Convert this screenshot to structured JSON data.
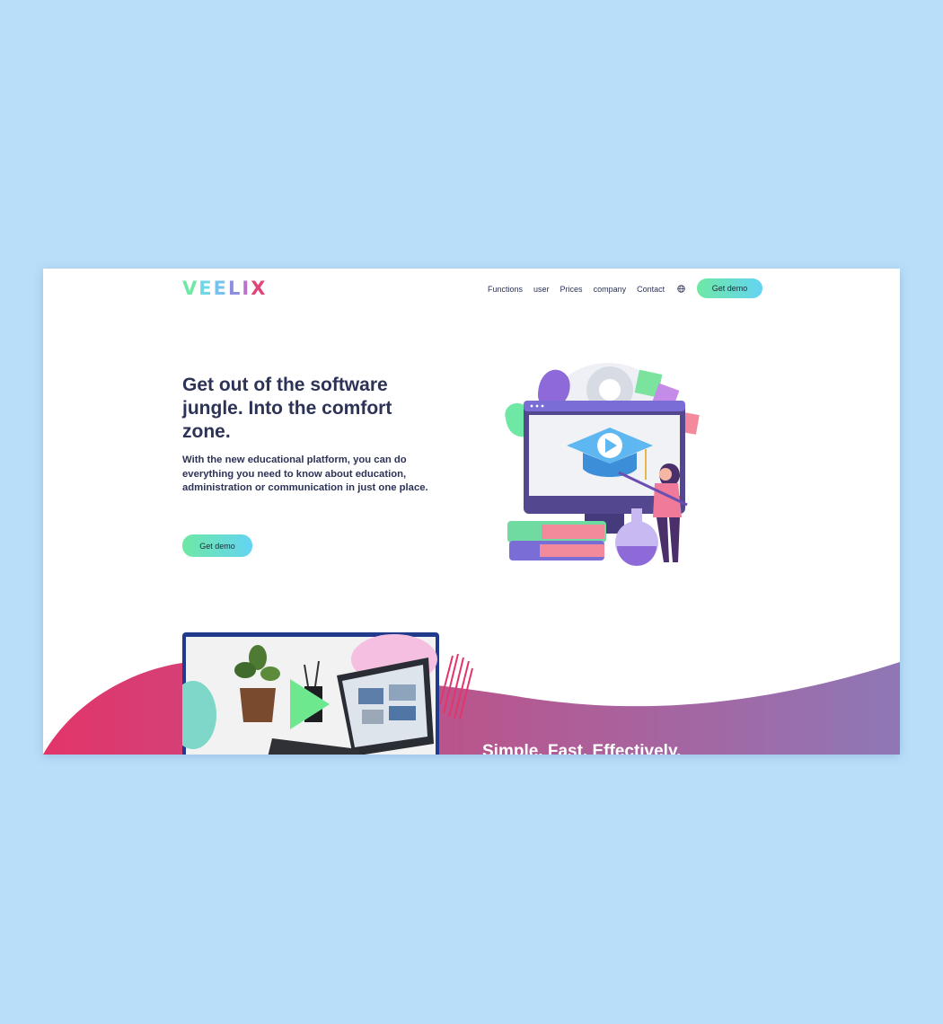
{
  "brand": {
    "logo_letters": [
      "V",
      "E",
      "E",
      "L",
      "I",
      "X"
    ],
    "logo_colors": [
      "#6ee8a4",
      "#6ed8e6",
      "#78c2ee",
      "#8c8ee0",
      "#b872cc",
      "#e0457a"
    ]
  },
  "nav": {
    "items": [
      {
        "label": "Functions"
      },
      {
        "label": "user"
      },
      {
        "label": "Prices"
      },
      {
        "label": "company"
      },
      {
        "label": "Contact"
      }
    ],
    "language_icon": "globe-icon",
    "cta_label": "Get demo"
  },
  "hero": {
    "title": "Get out of the software jungle. Into the comfort zone.",
    "text": "With the new educational platform, you can do everything you need to know about education, administration or communication in just one place.",
    "cta_label": "Get demo",
    "illustration": "education-video-illustration"
  },
  "section2": {
    "video_thumbnail": "laptop-video-thumbnail",
    "play_icon": "play-icon",
    "heading": "Simple. Fast. Effectively."
  },
  "colors": {
    "page_background": "#b8def9",
    "text_dark": "#2c3357",
    "button_gradient_start": "#6ee8a4",
    "button_gradient_end": "#64d4f2",
    "wave_gradient_start": "#e2356a",
    "wave_gradient_end": "#8f77b6"
  }
}
